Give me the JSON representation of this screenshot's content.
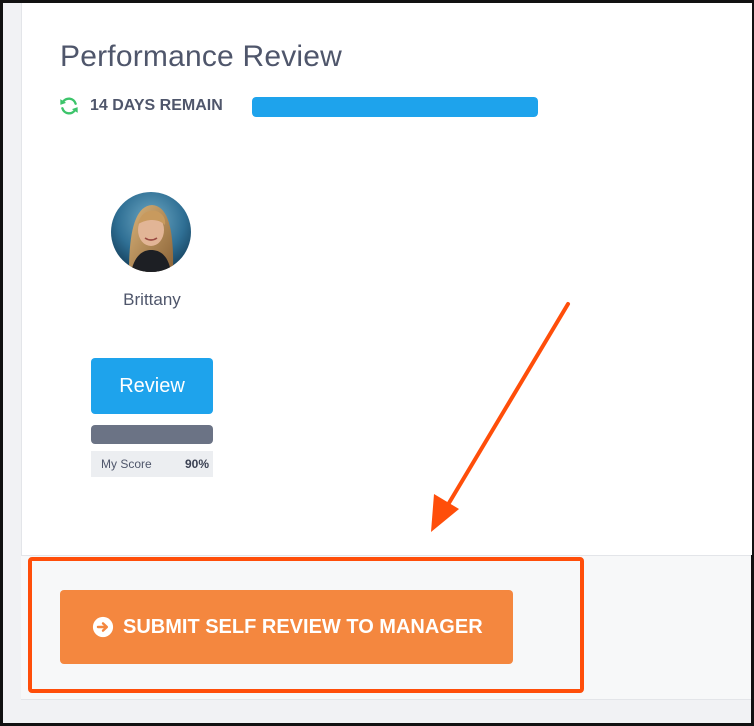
{
  "review": {
    "title": "Performance Review",
    "days_remaining_text": "14 DAYS REMAIN",
    "progress_fraction": 1.0
  },
  "employee": {
    "name": "Brittany",
    "review_button_label": "Review",
    "score_label": "My Score",
    "score_value": "90%"
  },
  "actions": {
    "submit_label": "SUBMIT SELF REVIEW TO MANAGER"
  },
  "icons": {
    "refresh": "refresh-icon",
    "submit": "arrow-circle-right-icon"
  },
  "colors": {
    "primary_blue": "#1ea3ec",
    "submit_orange": "#f4873f",
    "annotation_orange": "#ff4e0a",
    "refresh_green": "#3cc46a",
    "text_gray": "#4f566b",
    "score_bar": "#6b7385"
  }
}
